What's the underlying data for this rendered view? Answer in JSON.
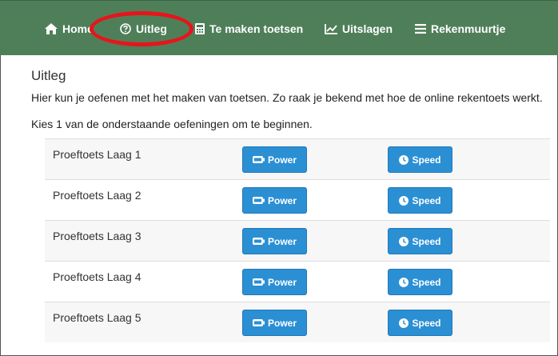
{
  "nav": {
    "home_label": "Home",
    "uitleg_label": "Uitleg",
    "toetsen_label": "Te maken toetsen",
    "uitslagen_label": "Uitslagen",
    "rekenmuurtje_label": "Rekenmuurtje",
    "icons": {
      "home": "home-icon",
      "uitleg": "question-circle-icon",
      "toetsen": "calculator-icon",
      "uitslagen": "line-chart-icon",
      "rekenmuurtje": "bars-icon"
    }
  },
  "page": {
    "title": "Uitleg",
    "intro": "Hier kun je oefenen met het maken van toetsen. Zo raak je bekend met hoe de online rekentoets werkt.",
    "instruction": "Kies 1 van de onderstaande oefeningen om te beginnen."
  },
  "exercises": [
    {
      "name": "Proeftoets Laag 1",
      "power_label": "Power",
      "speed_label": "Speed"
    },
    {
      "name": "Proeftoets Laag 2",
      "power_label": "Power",
      "speed_label": "Speed"
    },
    {
      "name": "Proeftoets Laag 3",
      "power_label": "Power",
      "speed_label": "Speed"
    },
    {
      "name": "Proeftoets Laag 4",
      "power_label": "Power",
      "speed_label": "Speed"
    },
    {
      "name": "Proeftoets Laag 5",
      "power_label": "Power",
      "speed_label": "Speed"
    }
  ],
  "colors": {
    "navbar": "#4f7f59",
    "button": "#2b8fd4",
    "highlight_ring": "#e8141b"
  }
}
